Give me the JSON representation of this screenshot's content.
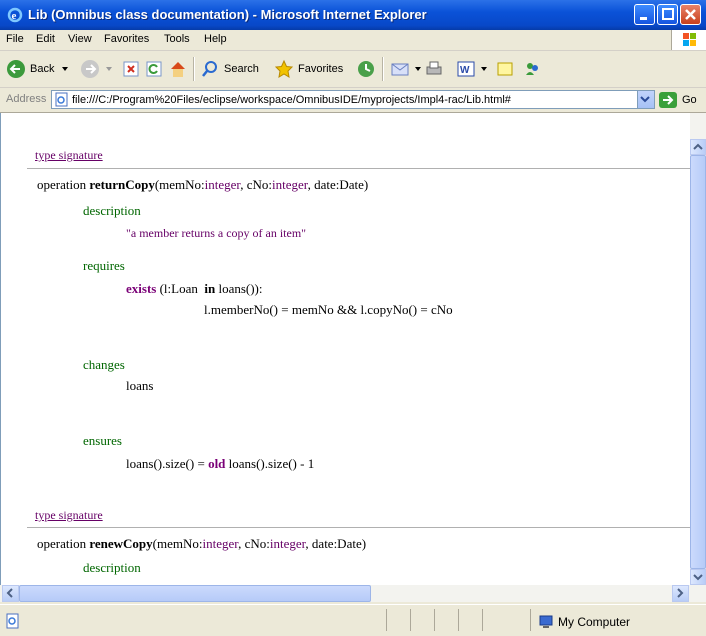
{
  "window": {
    "title": "Lib (Omnibus class documentation) - Microsoft Internet Explorer"
  },
  "menu": [
    "File",
    "Edit",
    "View",
    "Favorites",
    "Tools",
    "Help"
  ],
  "toolbar": {
    "back": "Back",
    "search": "Search",
    "favorites": "Favorites"
  },
  "address": {
    "label": "Address",
    "url": "file:///C:/Program%20Files/eclipse/workspace/OmnibusIDE/myprojects/Impl4-rac/Lib.html#",
    "go": "Go"
  },
  "status": {
    "zone": "My Computer"
  },
  "doc": {
    "sig1": "type signature",
    "op1": {
      "kw": "operation",
      "name": "returnCopy",
      "p1": "(memNo:",
      "t1": "integer",
      "p2": ", cNo:",
      "t2": "integer",
      "p3": ", date:Date)"
    },
    "description_heading": "description",
    "description_text": "\"a member returns a copy of an item\"",
    "requires_heading": "requires",
    "req_kw": "exists",
    "req_l1a": " (l:Loan  ",
    "req_in": "in",
    "req_l1b": " loans()):",
    "req_l2": "l.memberNo() = memNo && l.copyNo() = cNo",
    "changes_heading": "changes",
    "changes_text": "loans",
    "ensures_heading": "ensures",
    "ens_a": "loans().size() = ",
    "ens_old": "old",
    "ens_b": " loans().size() - 1",
    "sig2": "type signature",
    "op2": {
      "kw": "operation",
      "name": "renewCopy",
      "p1": "(memNo:",
      "t1": "integer",
      "p2": ", cNo:",
      "t2": "integer",
      "p3": ", date:Date)"
    },
    "description2_heading": "description"
  }
}
